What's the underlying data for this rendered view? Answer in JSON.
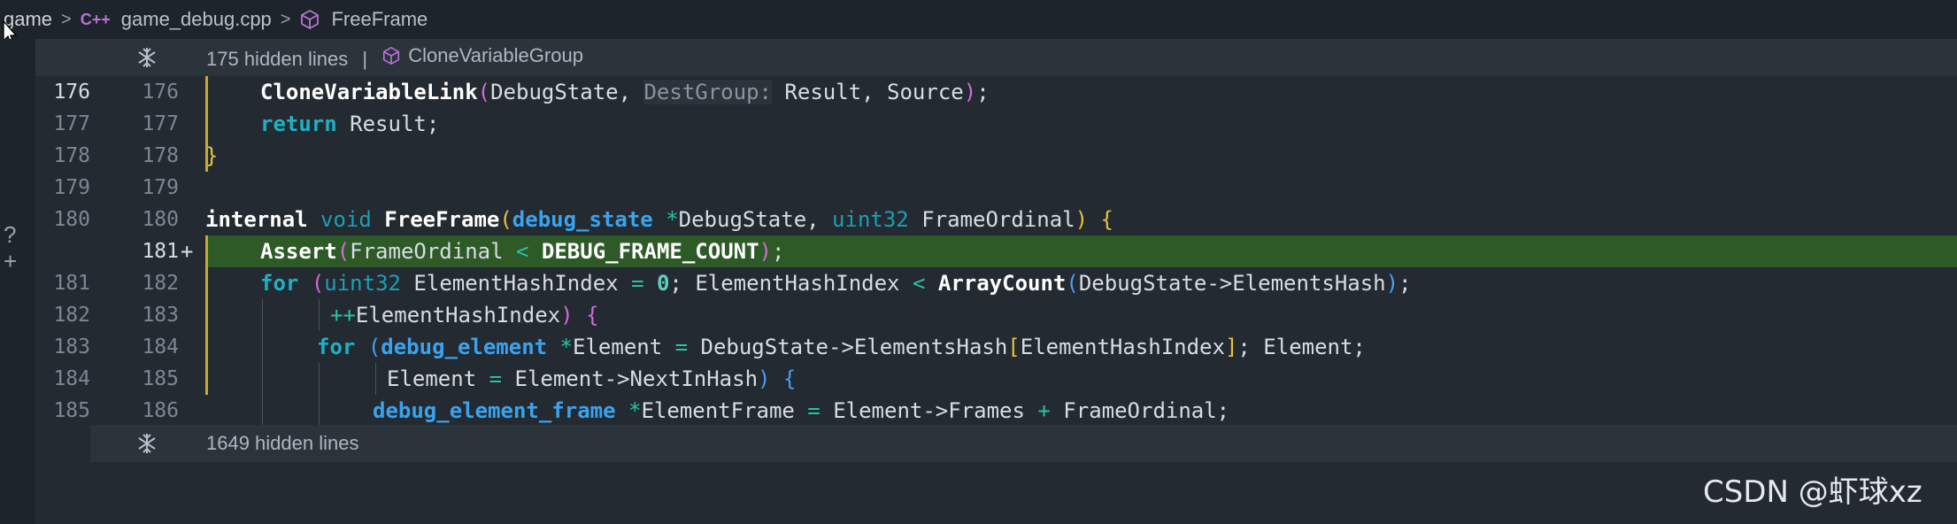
{
  "breadcrumb": {
    "folder": "game",
    "file_icon": "C++",
    "file": "game_debug.cpp",
    "symbol": "FreeFrame"
  },
  "fold_top": {
    "text": "175 hidden lines",
    "pipe": "|",
    "symbol": "CloneVariableGroup"
  },
  "fold_bottom": {
    "text": "1649 hidden lines"
  },
  "lines": [
    {
      "old": "176",
      "new": "176"
    },
    {
      "old": "177",
      "new": "177"
    },
    {
      "old": "178",
      "new": "178"
    },
    {
      "old": "179",
      "new": "179"
    },
    {
      "old": "180",
      "new": "180"
    },
    {
      "old": "",
      "new": "181",
      "marker": "+"
    },
    {
      "old": "181",
      "new": "182"
    },
    {
      "old": "182",
      "new": "183"
    },
    {
      "old": "183",
      "new": "184"
    },
    {
      "old": "184",
      "new": "185"
    },
    {
      "old": "185",
      "new": "186"
    }
  ],
  "code": {
    "l176": {
      "fn": "CloneVariableLink",
      "open": "(",
      "a1": "DebugState, ",
      "hint": "DestGroup:",
      "a2": " Result, Source",
      "close": ")",
      "semi": ";"
    },
    "l177": {
      "kw": "return",
      "rest": " Result;"
    },
    "l178": {
      "brace": "}"
    },
    "l180": {
      "kw1": "internal",
      "kw2": "void",
      "fn": "FreeFrame",
      "open": "(",
      "t1": "debug_state",
      "star": "*",
      "p1": "DebugState, ",
      "t2": "uint32",
      "p2": " FrameOrdinal",
      "close": ")",
      "brace": "{"
    },
    "l181": {
      "fn": "Assert",
      "open": "(",
      "p1": "FrameOrdinal ",
      "op": "<",
      "macro": " DEBUG_FRAME_COUNT",
      "close": ")",
      "semi": ";"
    },
    "l182": {
      "kw": "for",
      "open": "(",
      "t": "uint32",
      "p1": " ElementHashIndex ",
      "eq": "=",
      "num": " 0",
      "p2": "; ElementHashIndex ",
      "lt": "<",
      "fn": " ArrayCount",
      "open2": "(",
      "p3": "DebugState->ElementsHash",
      "close2": ")",
      "semi": ";"
    },
    "l183": {
      "inc": "++",
      "p1": "ElementHashIndex",
      "close": ")",
      "brace": " {"
    },
    "l184": {
      "kw": "for",
      "open": "(",
      "t": "debug_element",
      "star": " *",
      "p1": "Element ",
      "eq": "=",
      "p2": " DebugState->ElementsHash",
      "lb": "[",
      "p3": "ElementHashIndex",
      "rb": "]",
      "p4": "; Element;"
    },
    "l185": {
      "p1": "Element ",
      "eq": "=",
      "p2": " Element->NextInHash",
      "close": ")",
      "brace": " {"
    },
    "l186": {
      "t": "debug_element_frame",
      "star": " *",
      "p1": "ElementFrame ",
      "eq": "=",
      "p2": " Element->Frames ",
      "plus": "+",
      "p3": " FrameOrdinal;"
    }
  },
  "watermark": "CSDN @虾球xz"
}
